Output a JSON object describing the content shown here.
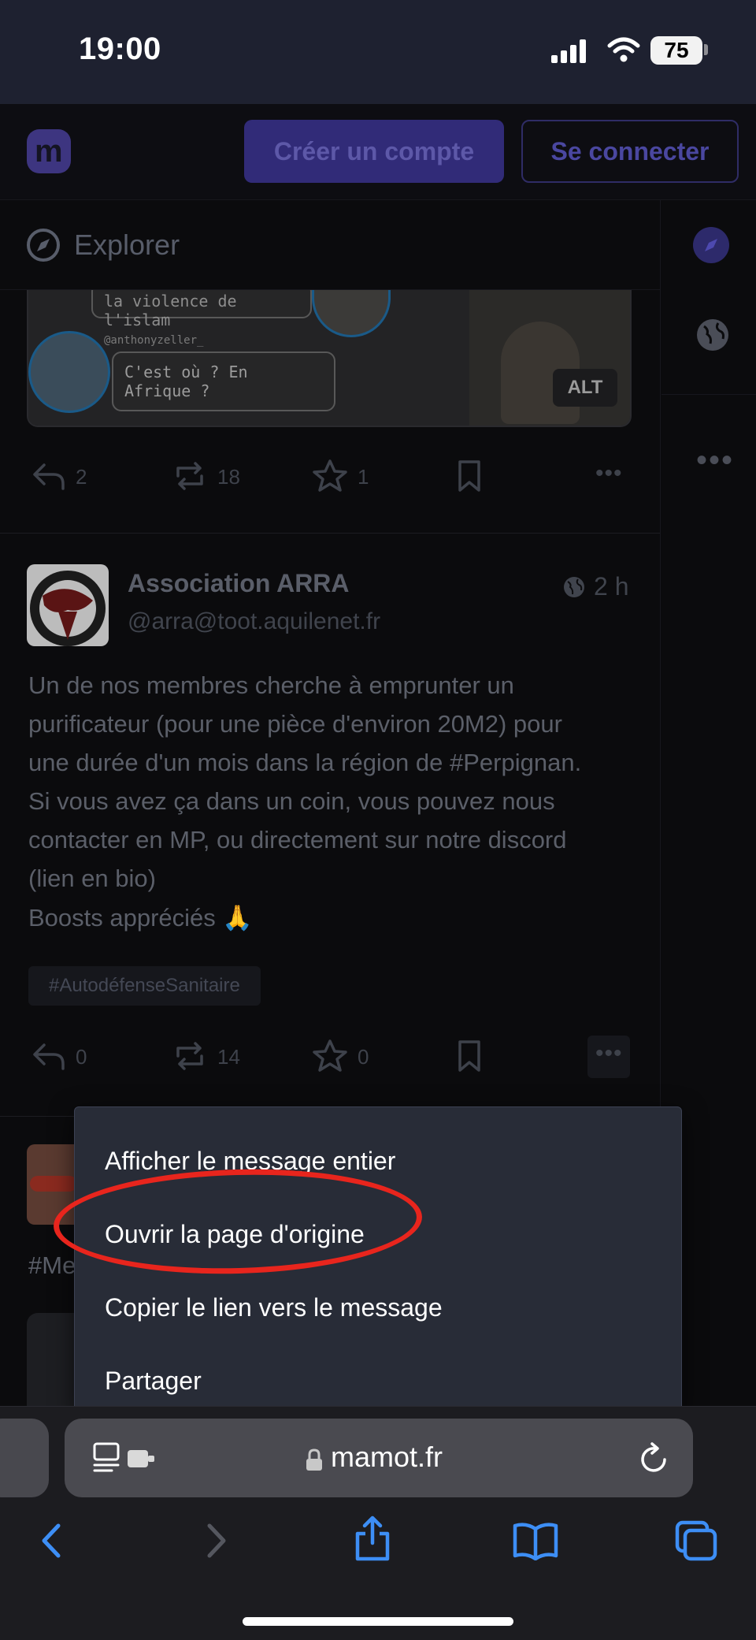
{
  "status_bar": {
    "time": "19:00",
    "battery": "75"
  },
  "header": {
    "create_account": "Créer un compte",
    "login": "Se connecter"
  },
  "explore": {
    "label": "Explorer"
  },
  "post1": {
    "image_texts": {
      "bubble_top": "la violence de l'islam",
      "handle": "@anthonyzeller_",
      "bubble": "C'est où ? En Afrique ?"
    },
    "alt_badge": "ALT",
    "replies": "2",
    "boosts": "18",
    "favourites": "1"
  },
  "post2": {
    "author": "Association ARRA",
    "handle": "@arra@toot.aquilenet.fr",
    "time": "2 h",
    "body_lines": [
      "Un de nos membres cherche à emprunter un",
      "purificateur (pour une pièce d'environ 20M2) pour",
      "une durée d'un mois dans la région de #Perpignan.",
      "Si vous avez ça dans un coin, vous pouvez nous",
      "contacter en MP, ou directement sur notre discord",
      "(lien en bio)",
      "Boosts appréciés 🙏"
    ],
    "hashtag": "#AutodéfenseSanitaire",
    "replies": "0",
    "boosts": "14",
    "favourites": "0"
  },
  "post3": {
    "text_fragment": "#Me"
  },
  "context_menu": {
    "items": [
      "Afficher le message entier",
      "Ouvrir la page d'origine",
      "Copier le lien vers le message",
      "Partager"
    ],
    "highlighted_index": 1,
    "highlight_color": "#e8251d"
  },
  "browser": {
    "url": "mamot.fr"
  },
  "icons": [
    "compass-icon",
    "globe-icon",
    "reply-icon",
    "boost-icon",
    "star-icon",
    "bookmark-icon",
    "more-icon",
    "lock-icon",
    "reload-icon",
    "back-icon",
    "forward-icon",
    "share-icon",
    "bookmarks-icon",
    "tabs-icon"
  ],
  "colors": {
    "accent": "#6364ff",
    "safari_blue": "#3d8ef5"
  }
}
